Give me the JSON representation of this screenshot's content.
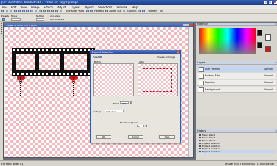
{
  "window": {
    "title": "Jasc Paint Shop Pro Photo X2 - Create Tut Tag.pspimage"
  },
  "menu": [
    "File",
    "Edit",
    "View",
    "Image",
    "Effects",
    "Adjust",
    "Layers",
    "Objects",
    "Selections",
    "Window",
    "Help"
  ],
  "toolbar": {
    "enhance_label": "Enhance Photo",
    "palettes_label": "Palettes",
    "zoom_out_label": "Zoom out",
    "zoom_in_label": "Zoom in",
    "modify_label": "Modify",
    "fill_label": "Fill"
  },
  "tool_options": {
    "presets": "Presets",
    "mode": "Mode",
    "feather": "Feather",
    "antialias": "Anti-alias",
    "use_all_layers": "Use all layers"
  },
  "canvas": {
    "title": "Image1 @ 100% (Film Frames)"
  },
  "dialog": {
    "title": "Expand Selection",
    "presets_label": "Presets",
    "preview_label": "Preview on Image",
    "before_label": "Before",
    "after_label": "After",
    "zoom_label": "Zoom",
    "zoom_value": "100",
    "settings_label": "Settings",
    "settings_value": "Last Used",
    "pixels_label": "Number of pixels",
    "pixels_value": "6",
    "ok": "OK",
    "cancel": "Cancel",
    "help": "Help"
  },
  "materials": {
    "title": "Materials"
  },
  "layers": {
    "title": "Layers",
    "items": [
      {
        "name": "Film Frames",
        "mode": "Normal"
      },
      {
        "name": "Bottom Tube",
        "mode": "Normal"
      },
      {
        "name": "Doodles",
        "mode": "Normal"
      },
      {
        "name": "Background",
        "mode": "Normal"
      }
    ]
  },
  "history": {
    "title": "History",
    "items": [
      "Magic Wand",
      "Magic Wand",
      "Magic Wand",
      "Expand Selection",
      "Expand Selection",
      "Expand Selection",
      "Expand Selection"
    ]
  },
  "status": {
    "left": "For Help, press F1",
    "right": "Image: 600 x 600 x RGB - 8 bits/channel"
  },
  "colors": {
    "accent": "#2d4f98",
    "checker": "#f3b9bd",
    "bow": "#c21a1a"
  }
}
